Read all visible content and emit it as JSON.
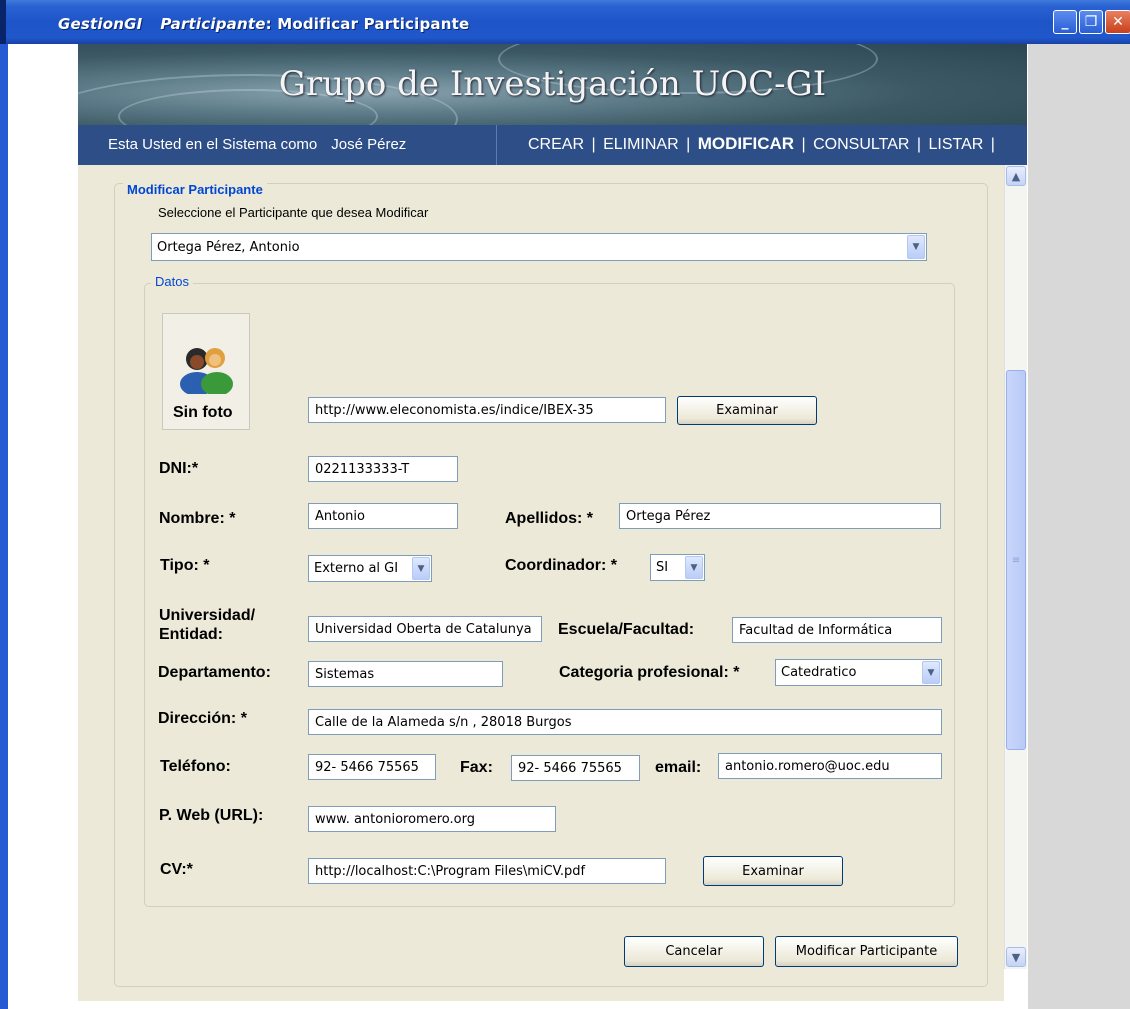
{
  "titlebar": {
    "app": "GestionGI",
    "section": "Participante",
    "action": ": Modificar Participante"
  },
  "banner": {
    "title": "Grupo de Investigación UOC-GI"
  },
  "navbar": {
    "session_label": "Esta Usted en el Sistema como",
    "user": "José Pérez",
    "menu": [
      "CREAR",
      "ELIMINAR",
      "MODIFICAR",
      "CONSULTAR",
      "LISTAR"
    ],
    "active": "MODIFICAR",
    "separator": "|"
  },
  "form": {
    "legend": "Modificar Participante",
    "hint": "Seleccione el Participante  que desea Modificar",
    "selected_participant": "Ortega Pérez, Antonio",
    "datos_legend": "Datos",
    "photo_label": "Sin foto",
    "photo_url": "http://www.eleconomista.es/indice/IBEX-35",
    "browse_label": "Examinar",
    "fields": {
      "dni_label": "DNI:*",
      "dni": "0221133333-T",
      "nombre_label": "Nombre: *",
      "nombre": "Antonio",
      "apellidos_label": "Apellidos: *",
      "apellidos": "Ortega Pérez",
      "tipo_label": "Tipo: *",
      "tipo": "Externo al GI",
      "coordinador_label": "Coordinador: *",
      "coordinador": "SI",
      "universidad_label_1": "Universidad/",
      "universidad_label_2": "Entidad:",
      "universidad": "Universidad Oberta de Catalunya",
      "escuela_label": "Escuela/Facultad:",
      "escuela": "Facultad de Informática",
      "departamento_label": "Departamento:",
      "departamento": "Sistemas",
      "categoria_label": "Categoria profesional: *",
      "categoria": "Catedratico",
      "direccion_label": "Dirección: *",
      "direccion": "Calle de la Alameda s/n , 28018 Burgos",
      "telefono_label": "Teléfono:",
      "telefono": "92- 5466 75565",
      "fax_label": "Fax:",
      "fax": "92- 5466 75565",
      "email_label": "email:",
      "email": "antonio.romero@uoc.edu",
      "web_label": "P. Web (URL):",
      "web": "www. antonioromero.org",
      "cv_label": "CV:*",
      "cv": "http://localhost:C:\\Program Files\\miCV.pdf"
    },
    "cancel_label": "Cancelar",
    "submit_label": "Modificar Participante"
  },
  "colors": {
    "titlebar": "#2058cc",
    "navbar": "#2d4e86",
    "legend": "#0046d5",
    "panel": "#ece9d8"
  }
}
